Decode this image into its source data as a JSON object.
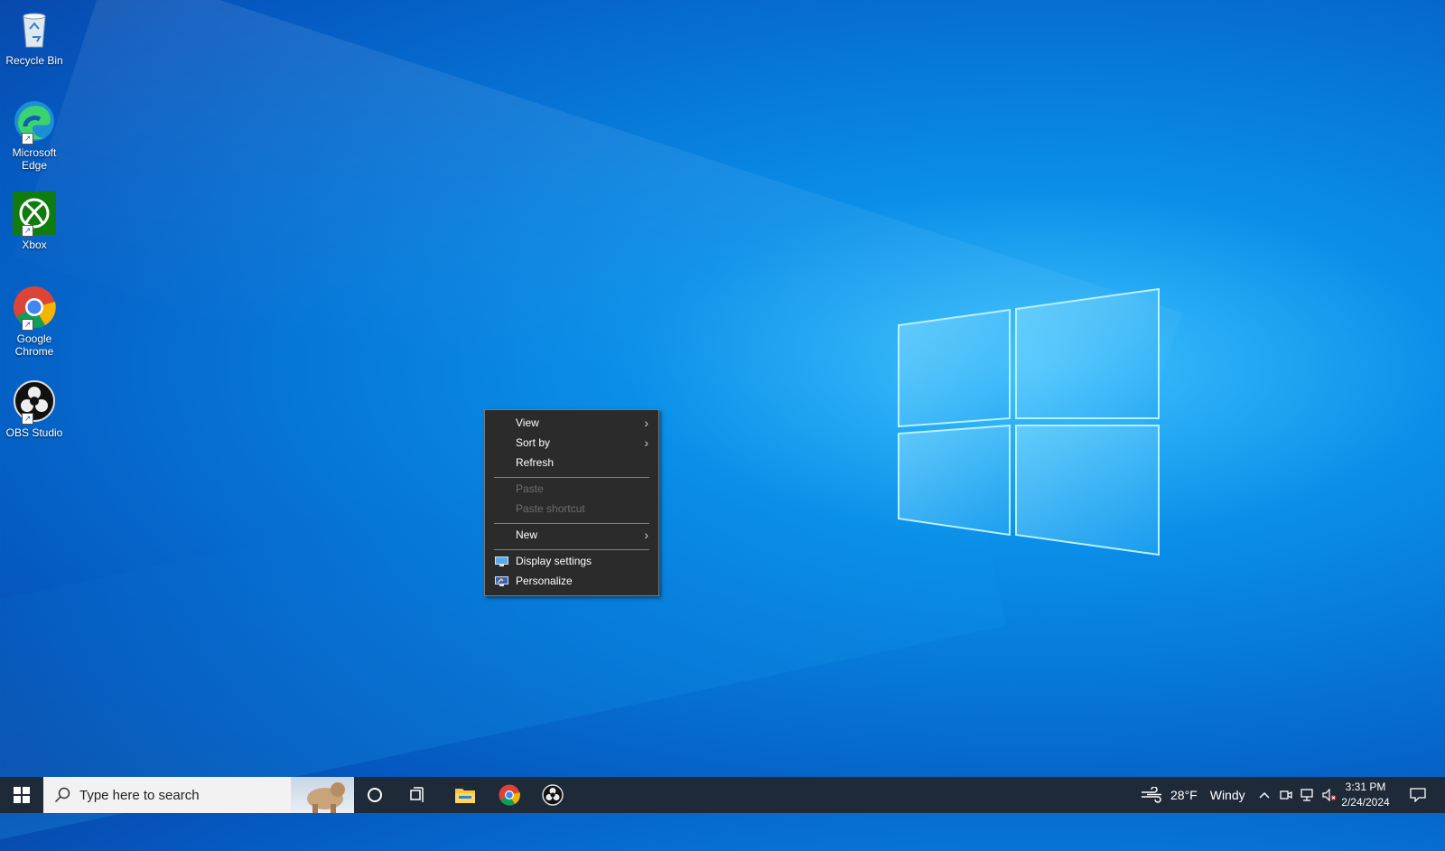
{
  "desktop": {
    "icons": [
      {
        "label": "Recycle Bin",
        "icon": "recycle-bin-icon"
      },
      {
        "label": "Microsoft Edge",
        "icon": "edge-icon"
      },
      {
        "label": "Xbox",
        "icon": "xbox-icon"
      },
      {
        "label": "Google Chrome",
        "icon": "chrome-icon"
      },
      {
        "label": "OBS Studio",
        "icon": "obs-icon"
      }
    ]
  },
  "context_menu": {
    "items": [
      {
        "label": "View",
        "submenu": true,
        "enabled": true
      },
      {
        "label": "Sort by",
        "submenu": true,
        "enabled": true
      },
      {
        "label": "Refresh",
        "submenu": false,
        "enabled": true
      },
      {
        "label": "Paste",
        "submenu": false,
        "enabled": false
      },
      {
        "label": "Paste shortcut",
        "submenu": false,
        "enabled": false
      },
      {
        "label": "New",
        "submenu": true,
        "enabled": true
      },
      {
        "label": "Display settings",
        "submenu": false,
        "enabled": true,
        "icon": "display-settings-icon"
      },
      {
        "label": "Personalize",
        "submenu": false,
        "enabled": true,
        "icon": "personalize-icon"
      }
    ]
  },
  "taskbar": {
    "search_placeholder": "Type here to search",
    "pinned": [
      "cortana-icon",
      "task-view-icon",
      "file-explorer-icon",
      "chrome-icon",
      "obs-icon"
    ],
    "weather": {
      "temp": "28°F",
      "condition": "Windy"
    },
    "clock": {
      "time": "3:31 PM",
      "date": "2/24/2024"
    }
  },
  "colors": {
    "menu_bg": "#2b2b2b",
    "menu_disabled": "#6d6d6d",
    "taskbar_bg": "#1f2a38"
  }
}
